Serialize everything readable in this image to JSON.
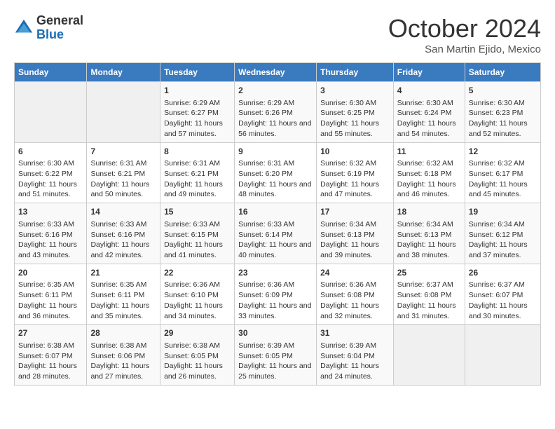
{
  "header": {
    "logo_line1": "General",
    "logo_line2": "Blue",
    "month_year": "October 2024",
    "location": "San Martin Ejido, Mexico"
  },
  "days_of_week": [
    "Sunday",
    "Monday",
    "Tuesday",
    "Wednesday",
    "Thursday",
    "Friday",
    "Saturday"
  ],
  "weeks": [
    [
      {
        "num": "",
        "data": ""
      },
      {
        "num": "",
        "data": ""
      },
      {
        "num": "1",
        "data": "Sunrise: 6:29 AM\nSunset: 6:27 PM\nDaylight: 11 hours and 57 minutes."
      },
      {
        "num": "2",
        "data": "Sunrise: 6:29 AM\nSunset: 6:26 PM\nDaylight: 11 hours and 56 minutes."
      },
      {
        "num": "3",
        "data": "Sunrise: 6:30 AM\nSunset: 6:25 PM\nDaylight: 11 hours and 55 minutes."
      },
      {
        "num": "4",
        "data": "Sunrise: 6:30 AM\nSunset: 6:24 PM\nDaylight: 11 hours and 54 minutes."
      },
      {
        "num": "5",
        "data": "Sunrise: 6:30 AM\nSunset: 6:23 PM\nDaylight: 11 hours and 52 minutes."
      }
    ],
    [
      {
        "num": "6",
        "data": "Sunrise: 6:30 AM\nSunset: 6:22 PM\nDaylight: 11 hours and 51 minutes."
      },
      {
        "num": "7",
        "data": "Sunrise: 6:31 AM\nSunset: 6:21 PM\nDaylight: 11 hours and 50 minutes."
      },
      {
        "num": "8",
        "data": "Sunrise: 6:31 AM\nSunset: 6:21 PM\nDaylight: 11 hours and 49 minutes."
      },
      {
        "num": "9",
        "data": "Sunrise: 6:31 AM\nSunset: 6:20 PM\nDaylight: 11 hours and 48 minutes."
      },
      {
        "num": "10",
        "data": "Sunrise: 6:32 AM\nSunset: 6:19 PM\nDaylight: 11 hours and 47 minutes."
      },
      {
        "num": "11",
        "data": "Sunrise: 6:32 AM\nSunset: 6:18 PM\nDaylight: 11 hours and 46 minutes."
      },
      {
        "num": "12",
        "data": "Sunrise: 6:32 AM\nSunset: 6:17 PM\nDaylight: 11 hours and 45 minutes."
      }
    ],
    [
      {
        "num": "13",
        "data": "Sunrise: 6:33 AM\nSunset: 6:16 PM\nDaylight: 11 hours and 43 minutes."
      },
      {
        "num": "14",
        "data": "Sunrise: 6:33 AM\nSunset: 6:16 PM\nDaylight: 11 hours and 42 minutes."
      },
      {
        "num": "15",
        "data": "Sunrise: 6:33 AM\nSunset: 6:15 PM\nDaylight: 11 hours and 41 minutes."
      },
      {
        "num": "16",
        "data": "Sunrise: 6:33 AM\nSunset: 6:14 PM\nDaylight: 11 hours and 40 minutes."
      },
      {
        "num": "17",
        "data": "Sunrise: 6:34 AM\nSunset: 6:13 PM\nDaylight: 11 hours and 39 minutes."
      },
      {
        "num": "18",
        "data": "Sunrise: 6:34 AM\nSunset: 6:13 PM\nDaylight: 11 hours and 38 minutes."
      },
      {
        "num": "19",
        "data": "Sunrise: 6:34 AM\nSunset: 6:12 PM\nDaylight: 11 hours and 37 minutes."
      }
    ],
    [
      {
        "num": "20",
        "data": "Sunrise: 6:35 AM\nSunset: 6:11 PM\nDaylight: 11 hours and 36 minutes."
      },
      {
        "num": "21",
        "data": "Sunrise: 6:35 AM\nSunset: 6:11 PM\nDaylight: 11 hours and 35 minutes."
      },
      {
        "num": "22",
        "data": "Sunrise: 6:36 AM\nSunset: 6:10 PM\nDaylight: 11 hours and 34 minutes."
      },
      {
        "num": "23",
        "data": "Sunrise: 6:36 AM\nSunset: 6:09 PM\nDaylight: 11 hours and 33 minutes."
      },
      {
        "num": "24",
        "data": "Sunrise: 6:36 AM\nSunset: 6:08 PM\nDaylight: 11 hours and 32 minutes."
      },
      {
        "num": "25",
        "data": "Sunrise: 6:37 AM\nSunset: 6:08 PM\nDaylight: 11 hours and 31 minutes."
      },
      {
        "num": "26",
        "data": "Sunrise: 6:37 AM\nSunset: 6:07 PM\nDaylight: 11 hours and 30 minutes."
      }
    ],
    [
      {
        "num": "27",
        "data": "Sunrise: 6:38 AM\nSunset: 6:07 PM\nDaylight: 11 hours and 28 minutes."
      },
      {
        "num": "28",
        "data": "Sunrise: 6:38 AM\nSunset: 6:06 PM\nDaylight: 11 hours and 27 minutes."
      },
      {
        "num": "29",
        "data": "Sunrise: 6:38 AM\nSunset: 6:05 PM\nDaylight: 11 hours and 26 minutes."
      },
      {
        "num": "30",
        "data": "Sunrise: 6:39 AM\nSunset: 6:05 PM\nDaylight: 11 hours and 25 minutes."
      },
      {
        "num": "31",
        "data": "Sunrise: 6:39 AM\nSunset: 6:04 PM\nDaylight: 11 hours and 24 minutes."
      },
      {
        "num": "",
        "data": ""
      },
      {
        "num": "",
        "data": ""
      }
    ]
  ]
}
